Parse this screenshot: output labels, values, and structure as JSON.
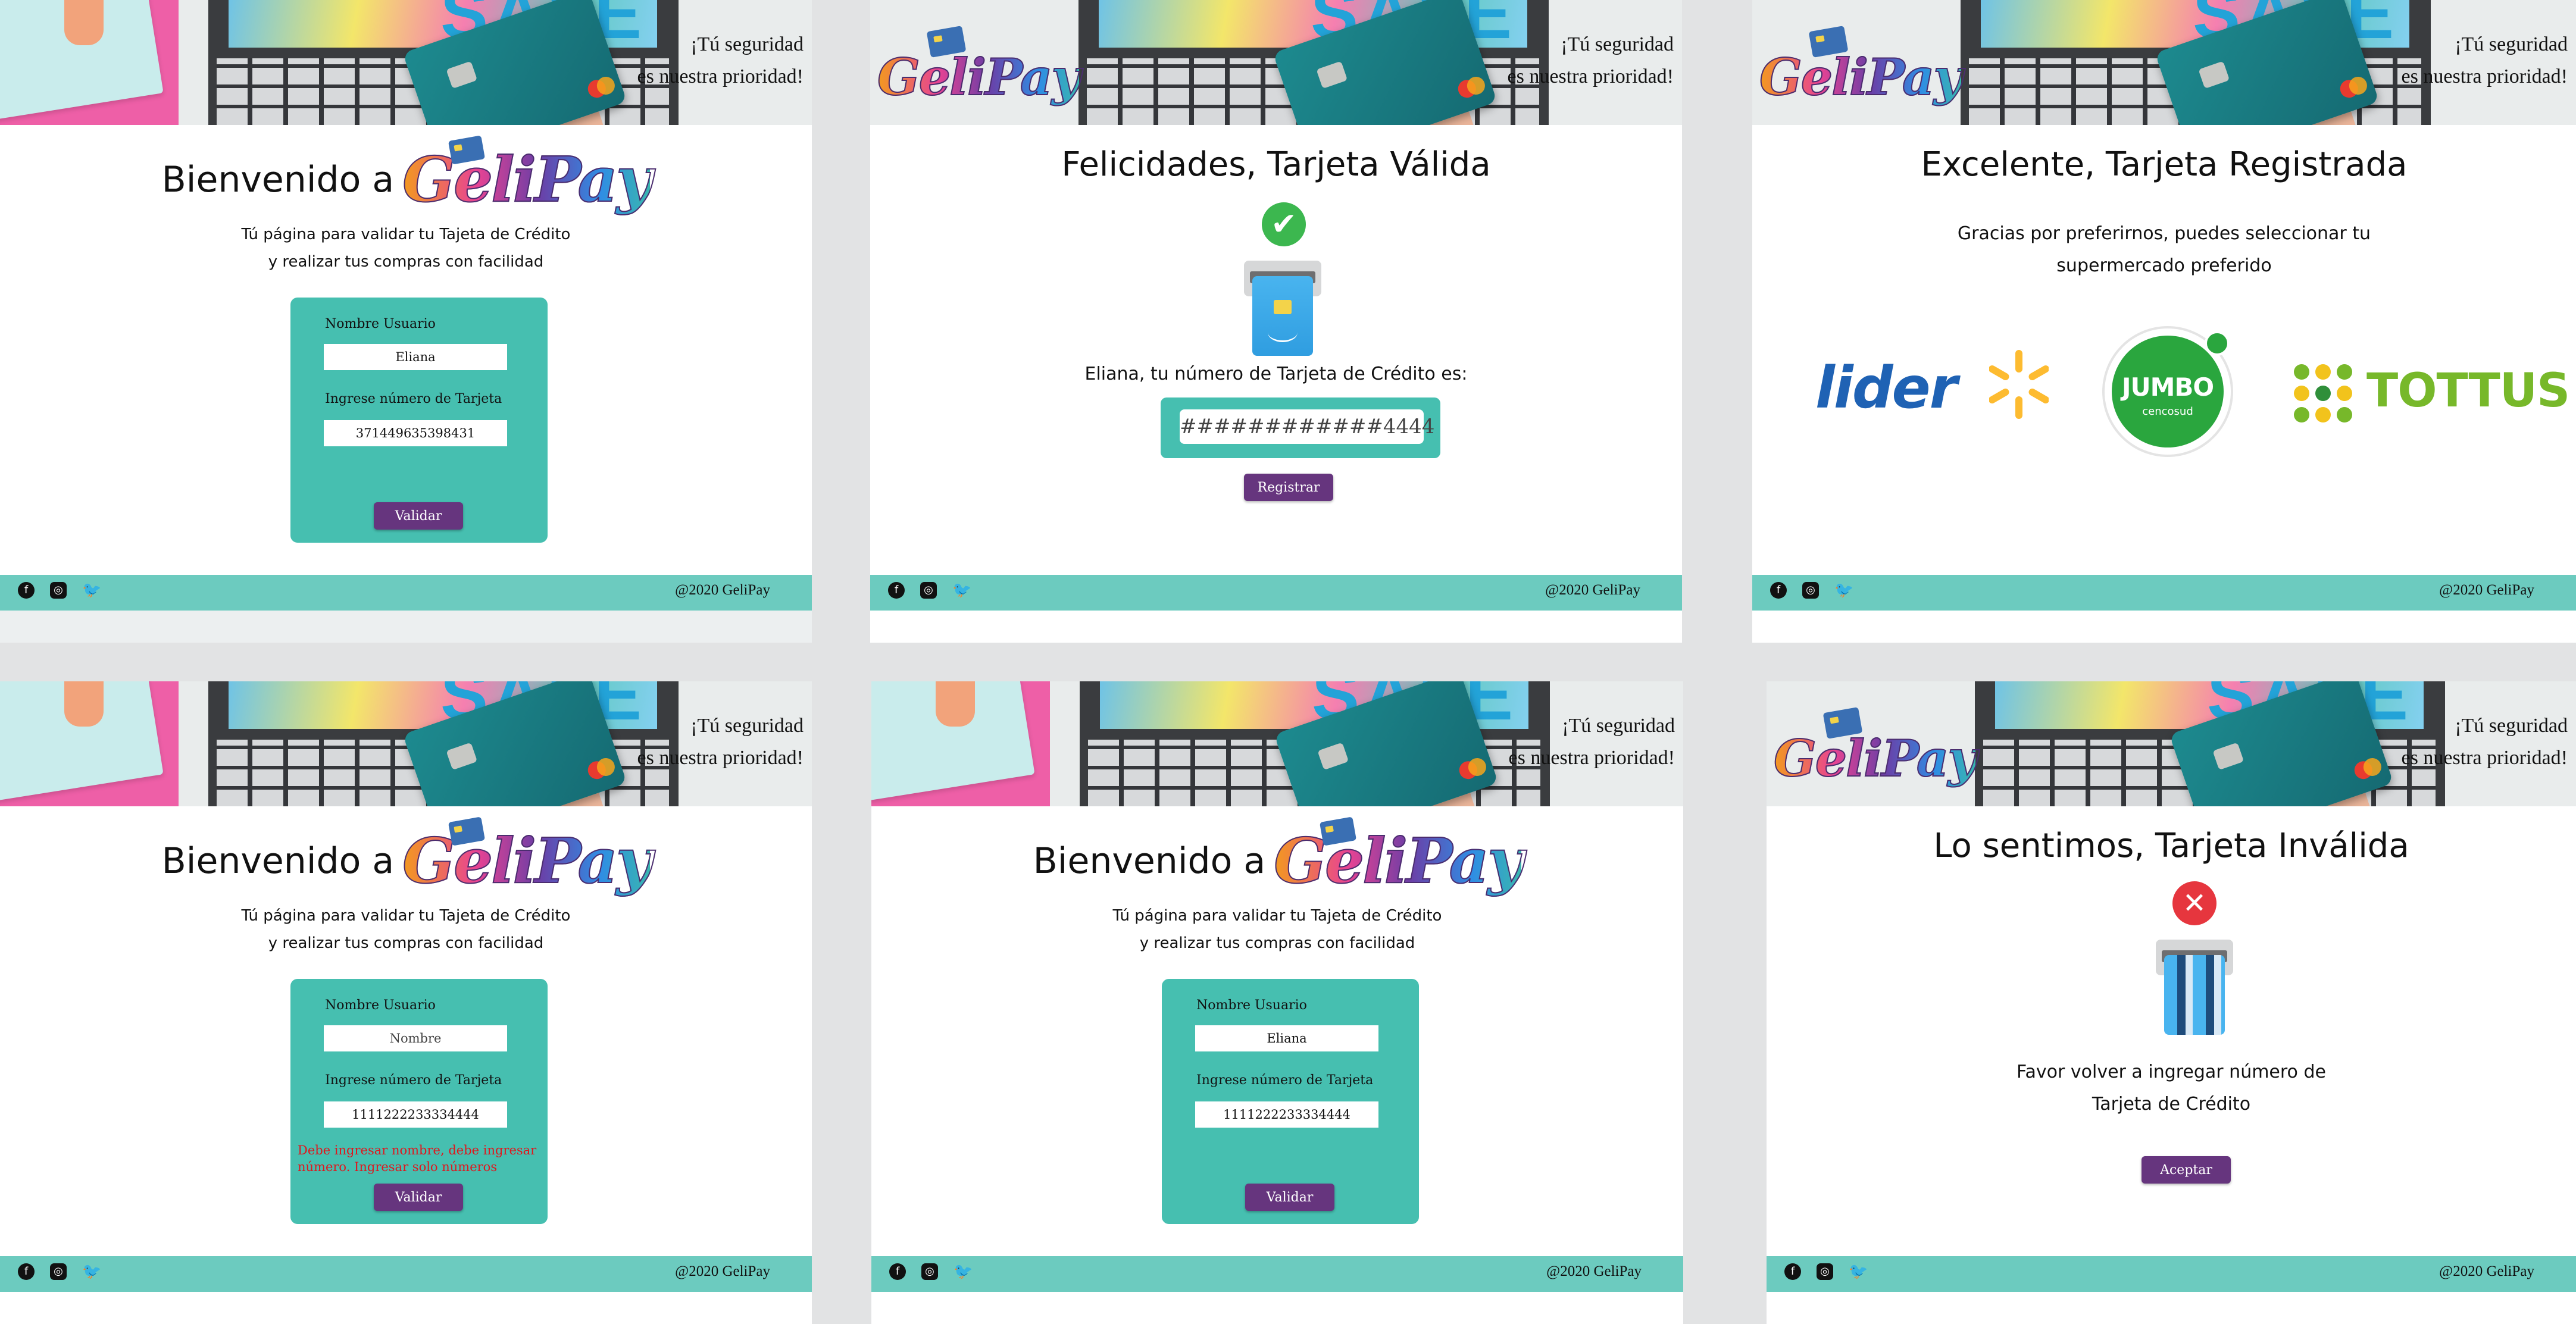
{
  "common": {
    "slogan_line1": "¡Tú seguridad",
    "slogan_line2": "es nuestra prioridad!",
    "sale_text": "SALE",
    "logo_text": "GeliPay",
    "copyright": "@2020 GeliPay",
    "social_icons": [
      "facebook-icon",
      "instagram-icon",
      "twitter-icon"
    ]
  },
  "welcome": {
    "title_prefix": "Bienvenido a",
    "subtitle_line1": "Tú página para validar tu Tajeta de Crédito",
    "subtitle_line2": "y realizar tus compras con facilidad",
    "user_label": "Nombre Usuario",
    "card_label": "Ingrese número de  Tarjeta",
    "validate_button": "Validar",
    "name_placeholder": "Nombre"
  },
  "screen1": {
    "user_value": "Eliana",
    "card_value": "371449635398431"
  },
  "screen2": {
    "title": "Felicidades, Tarjeta Válida",
    "message": "Eliana, tu número de Tarjeta de Crédito es:",
    "masked_card": "############4444",
    "register_button": "Registrar"
  },
  "screen3": {
    "title": "Excelente, Tarjeta Registrada",
    "message_line1": "Gracias por preferirnos, puedes seleccionar tu",
    "message_line2": "supermercado preferido",
    "supermarkets": [
      {
        "name": "lider",
        "color": "#1f62b4"
      },
      {
        "name": "JUMBO",
        "sub": "cencosud",
        "color": "#2aa63e"
      },
      {
        "name": "TOTTUS",
        "color": "#77b82a"
      }
    ]
  },
  "screen4": {
    "user_value": "",
    "card_value": "1111222233334444",
    "error": "Debe ingresar nombre, debe ingresar número. Ingresar solo números"
  },
  "screen5": {
    "user_value": "Eliana",
    "card_value": "1111222233334444"
  },
  "screen6": {
    "title": "Lo sentimos, Tarjeta Inválida",
    "message_line1": "Favor volver a ingregar número de",
    "message_line2": "Tarjeta de Crédito",
    "accept_button": "Aceptar"
  },
  "colors": {
    "teal": "#46bfb0",
    "footer": "#6ccbbf",
    "button": "#66357e",
    "error": "#e0161d",
    "valid": "#3cb74f",
    "invalid": "#e6363e"
  }
}
